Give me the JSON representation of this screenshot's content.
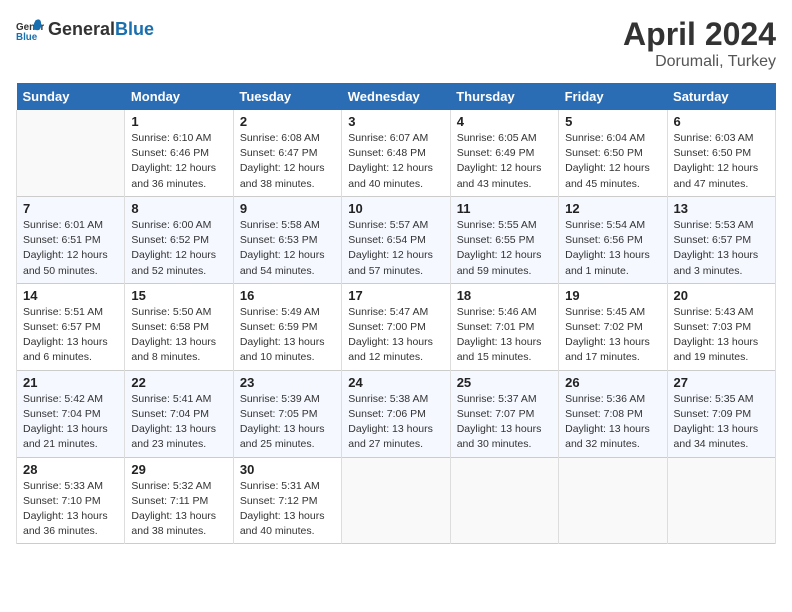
{
  "header": {
    "logo_general": "General",
    "logo_blue": "Blue",
    "month": "April 2024",
    "location": "Dorumali, Turkey"
  },
  "columns": [
    "Sunday",
    "Monday",
    "Tuesday",
    "Wednesday",
    "Thursday",
    "Friday",
    "Saturday"
  ],
  "weeks": [
    [
      {
        "day": "",
        "sunrise": "",
        "sunset": "",
        "daylight": ""
      },
      {
        "day": "1",
        "sunrise": "Sunrise: 6:10 AM",
        "sunset": "Sunset: 6:46 PM",
        "daylight": "Daylight: 12 hours and 36 minutes."
      },
      {
        "day": "2",
        "sunrise": "Sunrise: 6:08 AM",
        "sunset": "Sunset: 6:47 PM",
        "daylight": "Daylight: 12 hours and 38 minutes."
      },
      {
        "day": "3",
        "sunrise": "Sunrise: 6:07 AM",
        "sunset": "Sunset: 6:48 PM",
        "daylight": "Daylight: 12 hours and 40 minutes."
      },
      {
        "day": "4",
        "sunrise": "Sunrise: 6:05 AM",
        "sunset": "Sunset: 6:49 PM",
        "daylight": "Daylight: 12 hours and 43 minutes."
      },
      {
        "day": "5",
        "sunrise": "Sunrise: 6:04 AM",
        "sunset": "Sunset: 6:50 PM",
        "daylight": "Daylight: 12 hours and 45 minutes."
      },
      {
        "day": "6",
        "sunrise": "Sunrise: 6:03 AM",
        "sunset": "Sunset: 6:50 PM",
        "daylight": "Daylight: 12 hours and 47 minutes."
      }
    ],
    [
      {
        "day": "7",
        "sunrise": "Sunrise: 6:01 AM",
        "sunset": "Sunset: 6:51 PM",
        "daylight": "Daylight: 12 hours and 50 minutes."
      },
      {
        "day": "8",
        "sunrise": "Sunrise: 6:00 AM",
        "sunset": "Sunset: 6:52 PM",
        "daylight": "Daylight: 12 hours and 52 minutes."
      },
      {
        "day": "9",
        "sunrise": "Sunrise: 5:58 AM",
        "sunset": "Sunset: 6:53 PM",
        "daylight": "Daylight: 12 hours and 54 minutes."
      },
      {
        "day": "10",
        "sunrise": "Sunrise: 5:57 AM",
        "sunset": "Sunset: 6:54 PM",
        "daylight": "Daylight: 12 hours and 57 minutes."
      },
      {
        "day": "11",
        "sunrise": "Sunrise: 5:55 AM",
        "sunset": "Sunset: 6:55 PM",
        "daylight": "Daylight: 12 hours and 59 minutes."
      },
      {
        "day": "12",
        "sunrise": "Sunrise: 5:54 AM",
        "sunset": "Sunset: 6:56 PM",
        "daylight": "Daylight: 13 hours and 1 minute."
      },
      {
        "day": "13",
        "sunrise": "Sunrise: 5:53 AM",
        "sunset": "Sunset: 6:57 PM",
        "daylight": "Daylight: 13 hours and 3 minutes."
      }
    ],
    [
      {
        "day": "14",
        "sunrise": "Sunrise: 5:51 AM",
        "sunset": "Sunset: 6:57 PM",
        "daylight": "Daylight: 13 hours and 6 minutes."
      },
      {
        "day": "15",
        "sunrise": "Sunrise: 5:50 AM",
        "sunset": "Sunset: 6:58 PM",
        "daylight": "Daylight: 13 hours and 8 minutes."
      },
      {
        "day": "16",
        "sunrise": "Sunrise: 5:49 AM",
        "sunset": "Sunset: 6:59 PM",
        "daylight": "Daylight: 13 hours and 10 minutes."
      },
      {
        "day": "17",
        "sunrise": "Sunrise: 5:47 AM",
        "sunset": "Sunset: 7:00 PM",
        "daylight": "Daylight: 13 hours and 12 minutes."
      },
      {
        "day": "18",
        "sunrise": "Sunrise: 5:46 AM",
        "sunset": "Sunset: 7:01 PM",
        "daylight": "Daylight: 13 hours and 15 minutes."
      },
      {
        "day": "19",
        "sunrise": "Sunrise: 5:45 AM",
        "sunset": "Sunset: 7:02 PM",
        "daylight": "Daylight: 13 hours and 17 minutes."
      },
      {
        "day": "20",
        "sunrise": "Sunrise: 5:43 AM",
        "sunset": "Sunset: 7:03 PM",
        "daylight": "Daylight: 13 hours and 19 minutes."
      }
    ],
    [
      {
        "day": "21",
        "sunrise": "Sunrise: 5:42 AM",
        "sunset": "Sunset: 7:04 PM",
        "daylight": "Daylight: 13 hours and 21 minutes."
      },
      {
        "day": "22",
        "sunrise": "Sunrise: 5:41 AM",
        "sunset": "Sunset: 7:04 PM",
        "daylight": "Daylight: 13 hours and 23 minutes."
      },
      {
        "day": "23",
        "sunrise": "Sunrise: 5:39 AM",
        "sunset": "Sunset: 7:05 PM",
        "daylight": "Daylight: 13 hours and 25 minutes."
      },
      {
        "day": "24",
        "sunrise": "Sunrise: 5:38 AM",
        "sunset": "Sunset: 7:06 PM",
        "daylight": "Daylight: 13 hours and 27 minutes."
      },
      {
        "day": "25",
        "sunrise": "Sunrise: 5:37 AM",
        "sunset": "Sunset: 7:07 PM",
        "daylight": "Daylight: 13 hours and 30 minutes."
      },
      {
        "day": "26",
        "sunrise": "Sunrise: 5:36 AM",
        "sunset": "Sunset: 7:08 PM",
        "daylight": "Daylight: 13 hours and 32 minutes."
      },
      {
        "day": "27",
        "sunrise": "Sunrise: 5:35 AM",
        "sunset": "Sunset: 7:09 PM",
        "daylight": "Daylight: 13 hours and 34 minutes."
      }
    ],
    [
      {
        "day": "28",
        "sunrise": "Sunrise: 5:33 AM",
        "sunset": "Sunset: 7:10 PM",
        "daylight": "Daylight: 13 hours and 36 minutes."
      },
      {
        "day": "29",
        "sunrise": "Sunrise: 5:32 AM",
        "sunset": "Sunset: 7:11 PM",
        "daylight": "Daylight: 13 hours and 38 minutes."
      },
      {
        "day": "30",
        "sunrise": "Sunrise: 5:31 AM",
        "sunset": "Sunset: 7:12 PM",
        "daylight": "Daylight: 13 hours and 40 minutes."
      },
      {
        "day": "",
        "sunrise": "",
        "sunset": "",
        "daylight": ""
      },
      {
        "day": "",
        "sunrise": "",
        "sunset": "",
        "daylight": ""
      },
      {
        "day": "",
        "sunrise": "",
        "sunset": "",
        "daylight": ""
      },
      {
        "day": "",
        "sunrise": "",
        "sunset": "",
        "daylight": ""
      }
    ]
  ]
}
